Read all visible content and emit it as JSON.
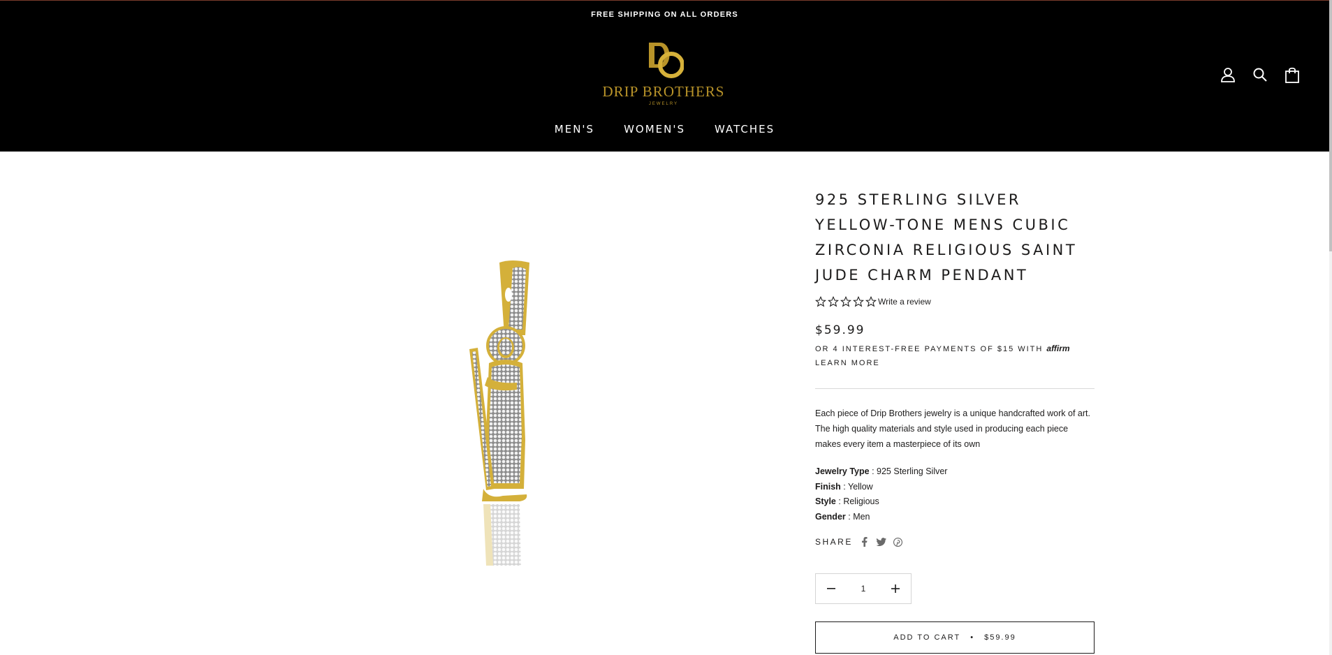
{
  "announcement": "FREE SHIPPING ON ALL ORDERS",
  "brand": {
    "monogram": "DO",
    "name": "DRIP BROTHERS",
    "tagline": "JEWELRY",
    "gold_color": "#b89329"
  },
  "header_icons": [
    "account-icon",
    "search-icon",
    "cart-icon"
  ],
  "nav": {
    "items": [
      {
        "label": "MEN'S"
      },
      {
        "label": "WOMEN'S"
      },
      {
        "label": "WATCHES"
      }
    ]
  },
  "product": {
    "title": "925 STERLING SILVER YELLOW-TONE MENS CUBIC ZIRCONIA RELIGIOUS SAINT JUDE CHARM PENDANT",
    "rating_stars": 0,
    "rating_max": 5,
    "write_review": "Write a review",
    "price": "$59.99",
    "affirm_text": "OR 4 INTEREST-FREE PAYMENTS OF $15 WITH",
    "affirm_logo": "affirm",
    "affirm_learn": "LEARN MORE",
    "description": "Each piece of Drip Brothers jewelry is a unique handcrafted work of art. The high quality materials and style used in producing each piece makes every item a masterpiece of its own",
    "specs": [
      {
        "label": "Jewelry Type",
        "value": ": 925 Sterling Silver"
      },
      {
        "label": "Finish",
        "value": ": Yellow"
      },
      {
        "label": "Style",
        "value": ": Religious"
      },
      {
        "label": "Gender",
        "value": ": Men"
      }
    ],
    "share_label": "SHARE",
    "share_icons": [
      "facebook-icon",
      "twitter-icon",
      "pinterest-icon"
    ],
    "quantity": "1",
    "add_to_cart": "ADD TO CART",
    "cart_separator": "•",
    "cart_price": "$59.99"
  },
  "colors": {
    "header_bg": "#000000",
    "text": "#1c1b1b",
    "gold": "#b89329"
  }
}
